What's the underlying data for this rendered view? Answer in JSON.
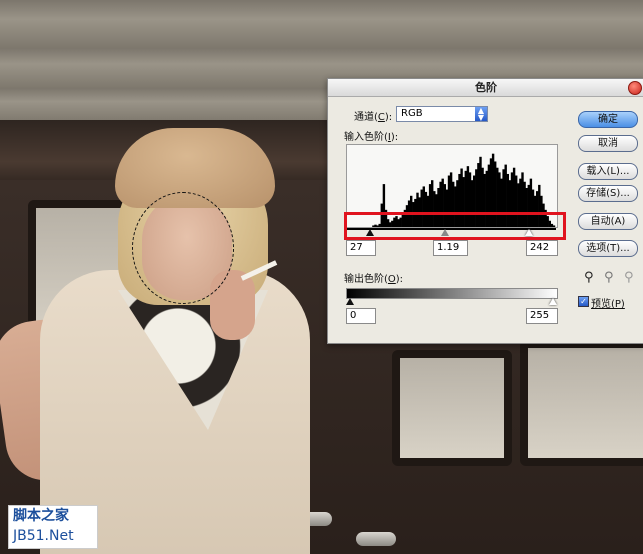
{
  "dialog": {
    "title": "色阶",
    "channel_label": "通道(C):",
    "channel_label_prefix": "通道(",
    "channel_label_key": "C",
    "channel_label_suffix": "):",
    "channel_value": "RGB",
    "input_levels_prefix": "输入色阶(",
    "input_levels_key": "I",
    "input_levels_suffix": "):",
    "input_black": "27",
    "input_gamma": "1.19",
    "input_white": "242",
    "output_levels_prefix": "输出色阶(",
    "output_levels_key": "O",
    "output_levels_suffix": "):",
    "output_black": "0",
    "output_white": "255",
    "buttons": {
      "ok": "确定",
      "cancel": "取消",
      "load": "载入(L)...",
      "save": "存储(S)...",
      "auto": "自动(A)",
      "options": "选项(T)..."
    },
    "preview_label": "预览(P)",
    "preview_checked": true,
    "histogram_values": [
      0,
      0,
      0,
      0,
      0,
      0,
      0,
      0,
      0,
      0,
      0,
      0,
      2,
      3,
      2,
      4,
      30,
      55,
      22,
      10,
      6,
      8,
      12,
      14,
      10,
      12,
      16,
      22,
      28,
      34,
      40,
      32,
      36,
      44,
      38,
      48,
      52,
      45,
      40,
      55,
      60,
      46,
      42,
      50,
      58,
      62,
      55,
      48,
      66,
      70,
      58,
      52,
      60,
      68,
      75,
      64,
      72,
      78,
      70,
      60,
      66,
      74,
      82,
      90,
      76,
      68,
      72,
      80,
      88,
      94,
      84,
      76,
      70,
      62,
      74,
      80,
      68,
      60,
      70,
      76,
      66,
      56,
      62,
      70,
      58,
      50,
      54,
      62,
      48,
      40,
      46,
      54,
      40,
      30,
      22,
      14,
      8,
      4,
      2,
      0
    ]
  },
  "watermark": {
    "line1": "脚本之家",
    "line2": "JB51.Net"
  }
}
